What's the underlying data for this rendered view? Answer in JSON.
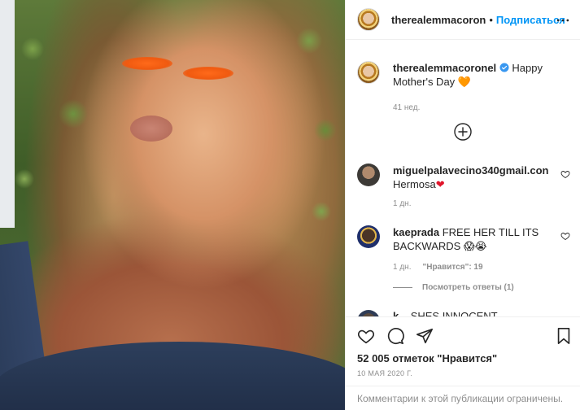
{
  "post": {
    "author": "therealemmacoron",
    "follow_label": "Подписаться",
    "separator": "•"
  },
  "caption": {
    "username": "therealemmacoronel",
    "text": "Happy Mother's Day",
    "emoji": "🧡",
    "time": "41 нед."
  },
  "comments": [
    {
      "username": "miguelpalavecino340gmail.con",
      "text": "Hermosa",
      "emoji": "❤",
      "time": "1 дн."
    },
    {
      "username": "kaeprada",
      "text": "FREE HER TILL ITS BACKWARDS",
      "emoji": "😱😭",
      "time": "1 дн.",
      "likes": "\"Нравится\": 19"
    }
  ],
  "replies_label": "Посмотреть ответы (1)",
  "partial_comment": {
    "username": "k...",
    "text": "SHES INNOCENT"
  },
  "footer": {
    "likes": "52 005 отметок \"Нравится\"",
    "date": "10 МАЯ 2020 Г.",
    "comments_restricted": "Комментарии к этой публикации ограничены."
  },
  "icons": {
    "more": "more-horizontal-icon",
    "add_comment": "plus-circle-icon",
    "like": "heart-outline-icon",
    "comment": "comment-bubble-icon",
    "share": "paper-plane-icon",
    "save": "bookmark-icon",
    "verified": "verified-badge-icon"
  },
  "colors": {
    "link_blue": "#0095f6",
    "verified_blue": "#3897f0",
    "text_primary": "#262626",
    "text_secondary": "#8e8e8e"
  }
}
